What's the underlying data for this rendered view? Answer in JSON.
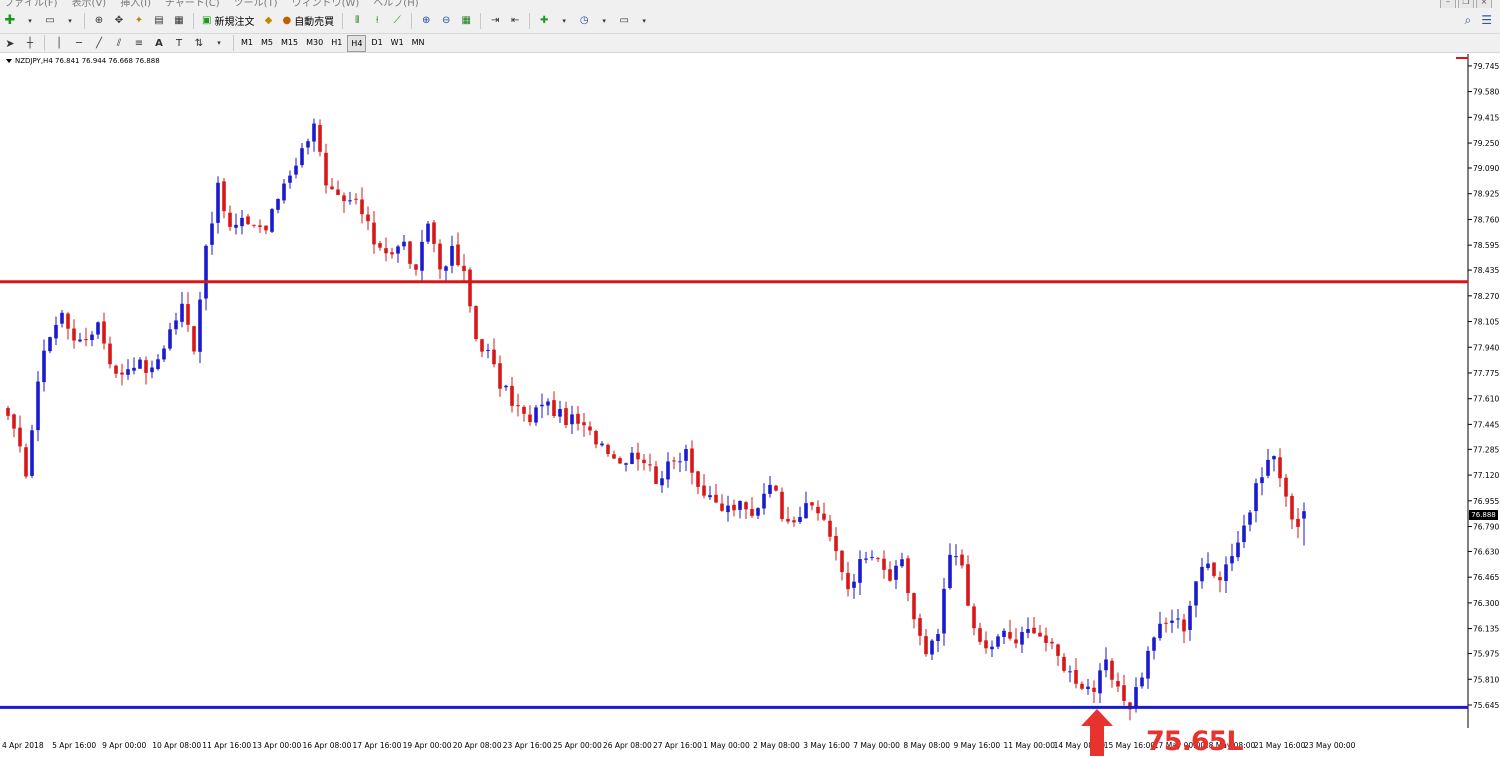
{
  "menu": {
    "items": [
      "ファイル(F)",
      "表示(V)",
      "挿入(I)",
      "チャート(C)",
      "ツール(T)",
      "ウィンドウ(W)",
      "ヘルプ(H)"
    ]
  },
  "toolbar": {
    "new_order_label": "新規注文",
    "auto_trade_label": "自動売買",
    "timeframes": [
      "M1",
      "M5",
      "M15",
      "M30",
      "H1",
      "H4",
      "D1",
      "W1",
      "MN"
    ],
    "active_timeframe": "H4"
  },
  "chart": {
    "title": "NZDJPY,H4  76.841 76.944 76.668 76.888",
    "current_price_label": "76.888",
    "annotation": "75.65L",
    "colors": {
      "bull": "#1a1ad0",
      "bear": "#d81818",
      "resistance": "#d81818",
      "support": "#1a1ad0",
      "arrow": "#e8322e"
    }
  },
  "chart_data": {
    "type": "candlestick",
    "symbol": "NZDJPY",
    "timeframe": "H4",
    "ohlc_header": {
      "open": 76.841,
      "high": 76.944,
      "low": 76.668,
      "close": 76.888
    },
    "y_ticks": [
      79.745,
      79.58,
      79.415,
      79.25,
      79.09,
      78.925,
      78.76,
      78.595,
      78.435,
      78.27,
      78.105,
      77.94,
      77.775,
      77.61,
      77.445,
      77.285,
      77.12,
      76.955,
      76.79,
      76.63,
      76.465,
      76.3,
      76.135,
      75.975,
      75.81,
      75.645
    ],
    "x_ticks": [
      "4 Apr 2018",
      "5 Apr 16:00",
      "9 Apr 00:00",
      "10 Apr 08:00",
      "11 Apr 16:00",
      "13 Apr 00:00",
      "16 Apr 08:00",
      "17 Apr 16:00",
      "19 Apr 00:00",
      "20 Apr 08:00",
      "23 Apr 16:00",
      "25 Apr 00:00",
      "26 Apr 08:00",
      "27 Apr 16:00",
      "1 May 00:00",
      "2 May 08:00",
      "3 May 16:00",
      "7 May 00:00",
      "8 May 08:00",
      "9 May 16:00",
      "11 May 00:00",
      "14 May 08:00",
      "15 May 16:00",
      "17 May 00:00",
      "18 May 08:00",
      "21 May 16:00",
      "23 May 00:00"
    ],
    "ylim": [
      75.6,
      79.77
    ],
    "horizontal_lines": [
      {
        "price": 78.36,
        "role": "resistance"
      },
      {
        "price": 75.63,
        "role": "support"
      }
    ],
    "close_path": [
      [
        0,
        77.5
      ],
      [
        3,
        77.15
      ],
      [
        6,
        77.95
      ],
      [
        9,
        78.15
      ],
      [
        12,
        77.95
      ],
      [
        15,
        78.1
      ],
      [
        18,
        77.75
      ],
      [
        21,
        77.85
      ],
      [
        24,
        77.78
      ],
      [
        27,
        78.05
      ],
      [
        29,
        78.2
      ],
      [
        31,
        77.95
      ],
      [
        33,
        78.6
      ],
      [
        35,
        78.95
      ],
      [
        37,
        78.7
      ],
      [
        40,
        78.75
      ],
      [
        43,
        78.7
      ],
      [
        46,
        79.0
      ],
      [
        49,
        79.2
      ],
      [
        51,
        79.4
      ],
      [
        53,
        78.95
      ],
      [
        56,
        78.85
      ],
      [
        58,
        78.88
      ],
      [
        61,
        78.62
      ],
      [
        64,
        78.55
      ],
      [
        66,
        78.6
      ],
      [
        68,
        78.4
      ],
      [
        70,
        78.75
      ],
      [
        72,
        78.45
      ],
      [
        74,
        78.55
      ],
      [
        76,
        78.4
      ],
      [
        78,
        78.0
      ],
      [
        80,
        77.9
      ],
      [
        82,
        77.7
      ],
      [
        84,
        77.6
      ],
      [
        87,
        77.45
      ],
      [
        89,
        77.6
      ],
      [
        92,
        77.5
      ],
      [
        95,
        77.45
      ],
      [
        97,
        77.38
      ],
      [
        100,
        77.3
      ],
      [
        102,
        77.2
      ],
      [
        104,
        77.28
      ],
      [
        106,
        77.22
      ],
      [
        108,
        77.1
      ],
      [
        111,
        77.2
      ],
      [
        113,
        77.3
      ],
      [
        115,
        77.05
      ],
      [
        117,
        76.95
      ],
      [
        119,
        76.9
      ],
      [
        122,
        76.92
      ],
      [
        124,
        76.85
      ],
      [
        127,
        77.1
      ],
      [
        129,
        76.88
      ],
      [
        131,
        76.85
      ],
      [
        134,
        76.92
      ],
      [
        136,
        76.85
      ],
      [
        138,
        76.6
      ],
      [
        140,
        76.4
      ],
      [
        142,
        76.55
      ],
      [
        144,
        76.6
      ],
      [
        147,
        76.45
      ],
      [
        149,
        76.55
      ],
      [
        151,
        76.2
      ],
      [
        153,
        75.95
      ],
      [
        155,
        76.1
      ],
      [
        157,
        76.6
      ],
      [
        159,
        76.55
      ],
      [
        161,
        76.1
      ],
      [
        163,
        76.0
      ],
      [
        166,
        76.1
      ],
      [
        168,
        76.05
      ],
      [
        171,
        76.15
      ],
      [
        173,
        76.05
      ],
      [
        175,
        75.95
      ],
      [
        177,
        75.85
      ],
      [
        179,
        75.78
      ],
      [
        181,
        75.75
      ],
      [
        183,
        75.9
      ],
      [
        185,
        75.72
      ],
      [
        187,
        75.65
      ],
      [
        189,
        75.85
      ],
      [
        191,
        76.1
      ],
      [
        194,
        76.2
      ],
      [
        196,
        76.15
      ],
      [
        198,
        76.45
      ],
      [
        200,
        76.55
      ],
      [
        202,
        76.48
      ],
      [
        205,
        76.7
      ],
      [
        207,
        76.9
      ],
      [
        209,
        77.15
      ],
      [
        211,
        77.25
      ],
      [
        213,
        76.95
      ],
      [
        215,
        76.8
      ],
      [
        216,
        76.888
      ]
    ],
    "xlabel": "",
    "ylabel": ""
  }
}
